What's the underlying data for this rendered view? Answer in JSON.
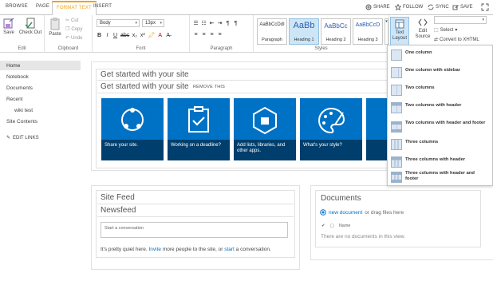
{
  "tabs": [
    "BROWSE",
    "PAGE",
    "FORMAT TEXT",
    "INSERT"
  ],
  "top_actions": {
    "share": "SHARE",
    "follow": "FOLLOW",
    "sync": "SYNC",
    "save": "SAVE"
  },
  "ribbon": {
    "edit": {
      "save": "Save",
      "checkout": "Check Out",
      "group": "Edit"
    },
    "clipboard": {
      "paste": "Paste",
      "cut": "Cut",
      "copy": "Copy",
      "undo": "Undo",
      "group": "Clipboard"
    },
    "font": {
      "family": "Body",
      "size": "13px",
      "group": "Font",
      "bold": "B",
      "italic": "I",
      "underline": "U"
    },
    "paragraph": {
      "group": "Paragraph"
    },
    "styles": {
      "group": "Styles",
      "items": [
        {
          "sample": "AaBbCcDdI",
          "name": "Paragraph"
        },
        {
          "sample": "AaBb",
          "name": "Heading 1"
        },
        {
          "sample": "AaBbCc",
          "name": "Heading 2"
        },
        {
          "sample": "AaBbCcD",
          "name": "Heading 3"
        }
      ]
    },
    "layout": {
      "text_layout": "Text Layout",
      "edit_source": "Edit Source",
      "select": "Select",
      "convert": "Convert to XHTML"
    }
  },
  "nav": {
    "items": [
      "Home",
      "Notebook",
      "Documents",
      "Recent",
      "wiki test",
      "Site Contents"
    ],
    "edit_links": "EDIT LINKS"
  },
  "get_started": {
    "title": "Get started with your site",
    "subtitle": "Get started with your site",
    "remove": "REMOVE THIS",
    "tiles": [
      "Share your site.",
      "Working on a deadline?",
      "Add lists, libraries, and other apps.",
      "What's your style?"
    ]
  },
  "site_feed": {
    "title": "Site Feed",
    "newsfeed": "Newsfeed",
    "placeholder": "Start a conversation",
    "quiet_text_a": "It's pretty quiet here.",
    "invite": "Invite",
    "quiet_text_b": "more people to the site, or",
    "start": "start",
    "quiet_text_c": "a conversation."
  },
  "documents": {
    "title": "Documents",
    "new_doc": "new document",
    "or_drag": "or drag files here",
    "col_name": "Name",
    "empty": "There are no documents in this view."
  },
  "layout_menu": {
    "items": [
      "One column",
      "One column with sidebar",
      "Two columns",
      "Two columns with header",
      "Two columns with header and footer",
      "Three columns",
      "Three columns with header",
      "Three columns with header and footer"
    ]
  },
  "colors": {
    "accent": "#0072c6",
    "tab_active": "#f4a21b"
  }
}
